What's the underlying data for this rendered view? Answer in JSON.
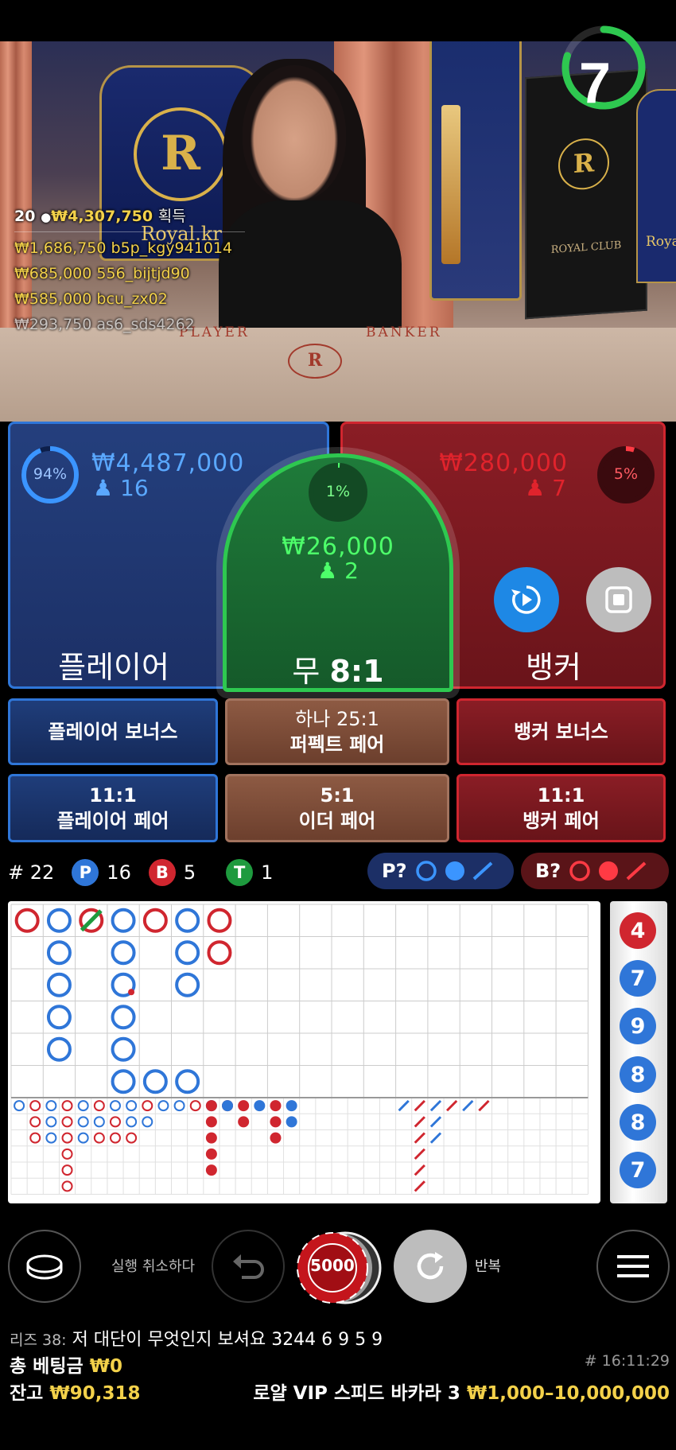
{
  "timer": {
    "value": "7",
    "fraction": 0.8
  },
  "video": {
    "logo_text": "Royal.kr",
    "logo_letter": "R",
    "logo_sub": "Royal",
    "club_text": "ROYAL CLUB",
    "table_player": "PLAYER",
    "table_banker": "BANKER",
    "royal_right": "Roya"
  },
  "winners": {
    "count": "20",
    "total": "₩4,307,750",
    "suffix": "획득",
    "list": [
      {
        "amount": "₩1,686,750",
        "name": "b5p_kgy941014"
      },
      {
        "amount": "₩685,000",
        "name": "556_bijtjd90"
      },
      {
        "amount": "₩585,000",
        "name": "bcu_zx02"
      },
      {
        "amount": "₩293,750",
        "name": "as6_sds4262"
      }
    ]
  },
  "player_bet": {
    "percent": "94%",
    "percent_value": 0.94,
    "amount": "₩4,487,000",
    "bettors": "16",
    "label": "플레이어"
  },
  "banker_bet": {
    "percent": "5%",
    "percent_value": 0.05,
    "amount": "₩280,000",
    "bettors": "7",
    "label": "뱅커"
  },
  "tie_bet": {
    "percent": "1%",
    "percent_value": 0.01,
    "amount": "₩26,000",
    "bettors": "2",
    "label": "무",
    "odds": "8:1"
  },
  "side_bets": {
    "player_bonus": "플레이어 보너스",
    "perfect_pair_top": "하나 25:1",
    "perfect_pair": "퍼펙트 페어",
    "banker_bonus": "뱅커 보너스",
    "player_pair_odds": "11:1",
    "player_pair": "플레이어 페어",
    "either_pair_odds": "5:1",
    "either_pair": "이더 페어",
    "banker_pair_odds": "11:1",
    "banker_pair": "뱅커 페어"
  },
  "stats": {
    "round_label": "#",
    "round": "22",
    "player_letter": "P",
    "player_wins": "16",
    "banker_letter": "B",
    "banker_wins": "5",
    "tie_letter": "T",
    "ties": "1",
    "player_predict": "P?",
    "banker_predict": "B?"
  },
  "side_road": [
    "4",
    "7",
    "9",
    "8",
    "8",
    "7"
  ],
  "side_road_colors": [
    "red",
    "blue",
    "blue",
    "blue",
    "blue",
    "blue"
  ],
  "controls": {
    "undo_label": "실행 취소하다",
    "repeat_label": "반복",
    "chip_value": "5000"
  },
  "chat": {
    "user": "리즈 38:",
    "message": "저 대단이 무엇인지 보셔요 3244 6 9 5 9"
  },
  "footer": {
    "total_bet_label": "총 베팅금",
    "total_bet": "₩0",
    "balance_label": "잔고",
    "balance": "₩90,318",
    "time": "# 16:11:29",
    "table_name": "로얄 VIP 스피드 바카라 3",
    "limits": "₩1,000–10,000,000"
  },
  "colors": {
    "player": "#2f76d8",
    "banker": "#d0262f",
    "tie": "#2ec850",
    "gold": "#f3d14a"
  }
}
